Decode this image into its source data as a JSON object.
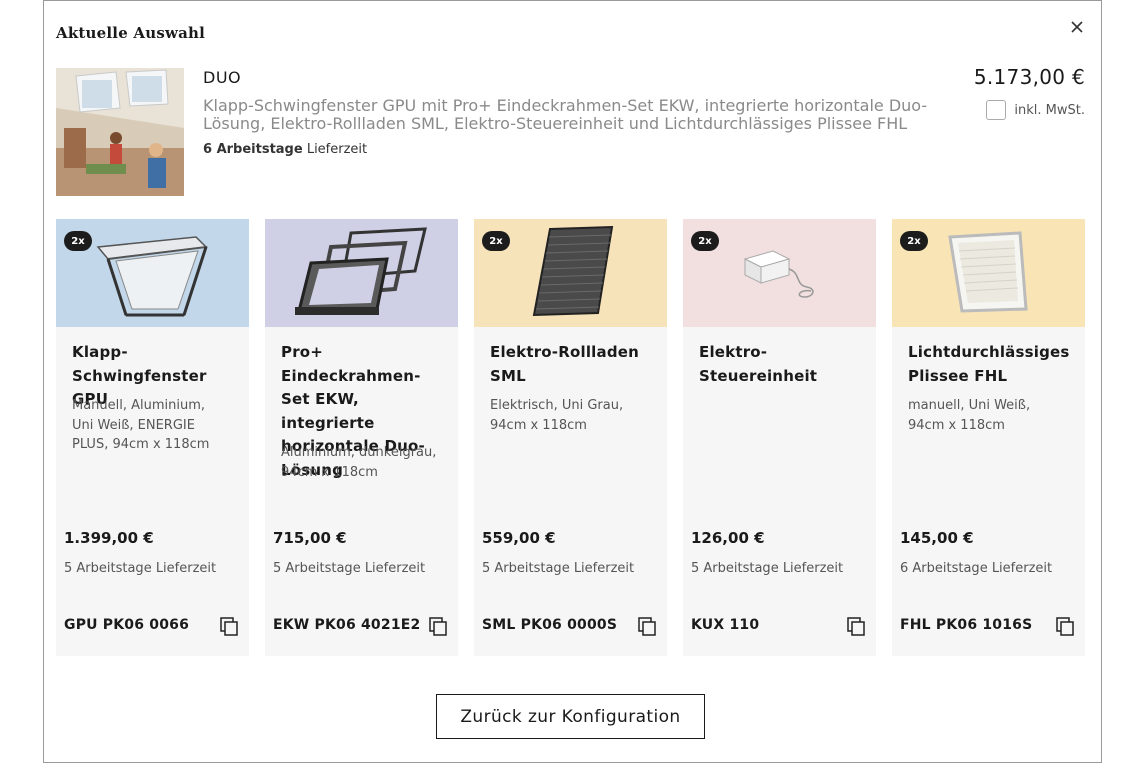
{
  "modal": {
    "title": "Aktuelle Auswahl"
  },
  "summary": {
    "name": "DUO",
    "description": "Klapp-Schwingfenster GPU mit Pro+ Eindeckrahmen-Set EKW, integrierte horizontale Duo-Lösung, Elektro-Rollladen SML, Elektro-Steuereinheit und Lichtdurchlässiges Plissee FHL",
    "delivery_days": "6 Arbeitstage",
    "delivery_suffix": " Lieferzeit",
    "price": "5.173,00 €",
    "vat_label": "inkl. MwSt.",
    "vat_checked": false
  },
  "products": [
    {
      "badge": "2x",
      "bg_color": "#c2d8ea",
      "icon": "roof-window-icon",
      "title": "Klapp-\nSchwingfenster GPU",
      "spec": "Manuell, Aluminium,\nUni Weiß, ENERGIE\nPLUS, 94cm x 118cm",
      "price": "1.399,00 €",
      "delivery": "5 Arbeitstage Lieferzeit",
      "code": "GPU PK06 0066"
    },
    {
      "badge": "",
      "bg_color": "#cfcfe5",
      "icon": "flashing-frame-icon",
      "title": "Pro+ Eindeckrahmen-\nSet EKW, integrierte\nhorizontale Duo-\nLösung",
      "spec": "Aluminium, dunkelgrau,\n94cm x 118cm",
      "price": "715,00 €",
      "delivery": "5 Arbeitstage Lieferzeit",
      "code": "EKW PK06 4021E2"
    },
    {
      "badge": "2x",
      "bg_color": "#f7e3b9",
      "icon": "roller-shutter-icon",
      "title": "Elektro-Rollladen\nSML",
      "spec": "Elektrisch, Uni Grau,\n94cm x 118cm",
      "price": "559,00 €",
      "delivery": "5 Arbeitstage Lieferzeit",
      "code": "SML PK06 0000S"
    },
    {
      "badge": "2x",
      "bg_color": "#f2dfe0",
      "icon": "control-unit-icon",
      "title": "Elektro-\nSteuereinheit",
      "spec": "",
      "price": "126,00 €",
      "delivery": "5 Arbeitstage Lieferzeit",
      "code": "KUX 110"
    },
    {
      "badge": "2x",
      "bg_color": "#f9e4b5",
      "icon": "pleated-blind-icon",
      "title": "Lichtdurchlässiges\nPlissee FHL",
      "spec": "manuell, Uni Weiß,\n94cm x 118cm",
      "price": "145,00 €",
      "delivery": "6 Arbeitstage Lieferzeit",
      "code": "FHL PK06 1016S"
    }
  ],
  "footer": {
    "back_label": "Zurück zur Konfiguration"
  }
}
